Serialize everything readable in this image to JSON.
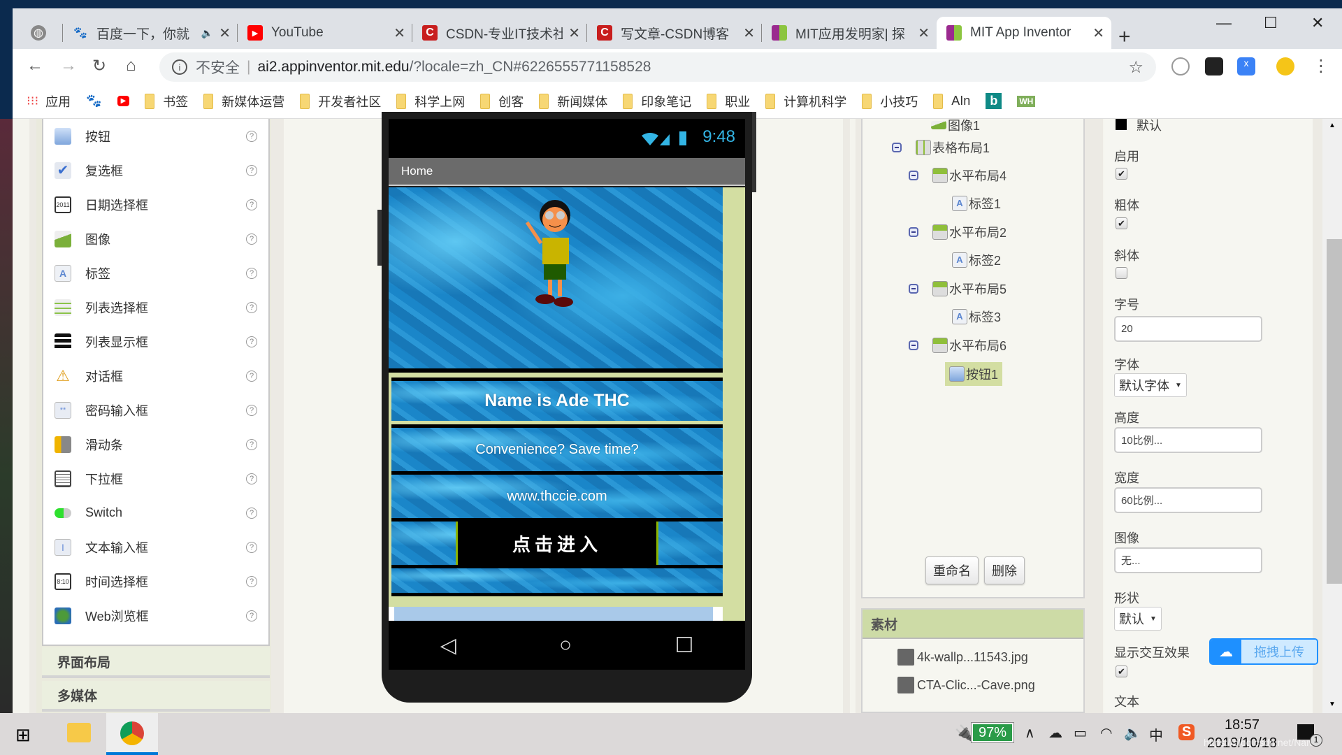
{
  "browser": {
    "tabs": [
      {
        "title": "",
        "icon": "globe-icon",
        "active": false
      },
      {
        "title": "百度一下，你就",
        "icon": "baidu-icon",
        "audio": true,
        "active": false
      },
      {
        "title": "YouTube",
        "icon": "youtube-icon",
        "active": false
      },
      {
        "title": "CSDN-专业IT技术社",
        "icon": "csdn-icon",
        "active": false
      },
      {
        "title": "写文章-CSDN博客",
        "icon": "csdn-icon",
        "active": false
      },
      {
        "title": "MIT应用发明家| 探",
        "icon": "appinventor-icon",
        "active": false
      },
      {
        "title": "MIT App Inventor",
        "icon": "appinventor-icon",
        "active": true
      }
    ],
    "new_tab": "+",
    "window_controls": {
      "minimize": "—",
      "maximize": "☐",
      "close": "✕"
    },
    "address": {
      "security": "不安全",
      "host": "ai2.appinventor.mit.edu",
      "path": "/?locale=zh_CN#6226555771158528"
    },
    "bookmarks": [
      "应用",
      "书签",
      "新媒体运营",
      "开发者社区",
      "科学上网",
      "创客",
      "新闻媒体",
      "印象笔记",
      "职业",
      "计算机科学",
      "小技巧",
      "AIn"
    ]
  },
  "palette": {
    "items": [
      {
        "label": "按钮",
        "icon": "button-icon"
      },
      {
        "label": "复选框",
        "icon": "checkbox-icon"
      },
      {
        "label": "日期选择框",
        "icon": "datepicker-icon"
      },
      {
        "label": "图像",
        "icon": "image-icon"
      },
      {
        "label": "标签",
        "icon": "label-icon"
      },
      {
        "label": "列表选择框",
        "icon": "listpicker-icon"
      },
      {
        "label": "列表显示框",
        "icon": "listview-icon"
      },
      {
        "label": "对话框",
        "icon": "notifier-icon"
      },
      {
        "label": "密码输入框",
        "icon": "password-icon"
      },
      {
        "label": "滑动条",
        "icon": "slider-icon"
      },
      {
        "label": "下拉框",
        "icon": "spinner-icon"
      },
      {
        "label": "Switch",
        "icon": "switch-icon"
      },
      {
        "label": "文本输入框",
        "icon": "textbox-icon"
      },
      {
        "label": "时间选择框",
        "icon": "timepicker-icon"
      },
      {
        "label": "Web浏览框",
        "icon": "webviewer-icon"
      }
    ],
    "help": "?",
    "groups": [
      "界面布局",
      "多媒体"
    ]
  },
  "phone": {
    "time": "9:48",
    "title": "Home",
    "label1": "Name is Ade THC",
    "label2": "Convenience?  Save time?",
    "label3": "www.thccie.com",
    "button1": "点击进入",
    "nav": {
      "back": "◁",
      "home": "○",
      "recent": "☐"
    }
  },
  "tree": {
    "nodes": [
      {
        "label": "图像1",
        "icon": "image-icon",
        "level": 1,
        "toggle": false
      },
      {
        "label": "表格布局1",
        "icon": "table-layout-icon",
        "level": 0,
        "toggle": true
      },
      {
        "label": "水平布局4",
        "icon": "horizontal-layout-icon",
        "level": 1,
        "toggle": true
      },
      {
        "label": "标签1",
        "icon": "label-icon",
        "level": 2,
        "toggle": false
      },
      {
        "label": "水平布局2",
        "icon": "horizontal-layout-icon",
        "level": 1,
        "toggle": true
      },
      {
        "label": "标签2",
        "icon": "label-icon",
        "level": 2,
        "toggle": false
      },
      {
        "label": "水平布局5",
        "icon": "horizontal-layout-icon",
        "level": 1,
        "toggle": true
      },
      {
        "label": "标签3",
        "icon": "label-icon",
        "level": 2,
        "toggle": false
      },
      {
        "label": "水平布局6",
        "icon": "horizontal-layout-icon",
        "level": 1,
        "toggle": true
      },
      {
        "label": "按钮1",
        "icon": "button-icon",
        "level": 2,
        "toggle": false,
        "selected": true
      }
    ],
    "rename": "重命名",
    "delete": "删除"
  },
  "media": {
    "title": "素材",
    "assets": [
      "4k-wallp...11543.jpg",
      "CTA-Clic...-Cave.png"
    ]
  },
  "properties": {
    "textcolor_value": "默认",
    "enabled_label": "启用",
    "enabled": true,
    "bold_label": "粗体",
    "bold": true,
    "italic_label": "斜体",
    "italic": false,
    "fontsize_label": "字号",
    "fontsize": "20",
    "fontface_label": "字体",
    "fontface": "默认字体",
    "height_label": "高度",
    "height": "10比例...",
    "width_label": "宽度",
    "width": "60比例...",
    "image_label": "图像",
    "image": "无...",
    "shape_label": "形状",
    "shape": "默认",
    "feedback_label": "显示交互效果",
    "feedback": true,
    "text_label": "文本",
    "upload_label": "拖拽上传"
  },
  "taskbar": {
    "battery": "97%",
    "ime": "中",
    "time": "18:57",
    "date": "2019/10/18",
    "notifications": "1",
    "watermark": "https://blog.csdn.net/Naiva"
  },
  "colors": {
    "accent_green": "#d3dea2",
    "phone_clock": "#33b5e5",
    "media_header": "#cddba6"
  }
}
